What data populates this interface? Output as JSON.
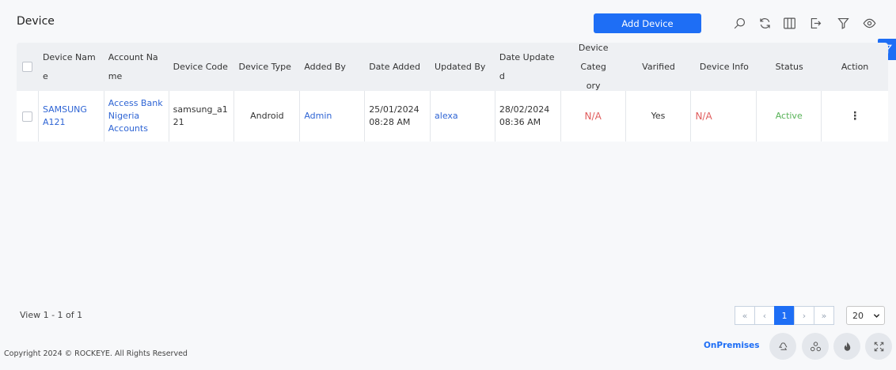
{
  "page": {
    "title": "Device"
  },
  "toolbar": {
    "add_label": "Add Device",
    "icons": [
      "search-icon",
      "refresh-icon",
      "columns-icon",
      "export-icon",
      "filter-icon",
      "view-icon"
    ]
  },
  "table": {
    "headers": [
      "Device Name",
      "Account Name",
      "Device Code",
      "Device Type",
      "Added By",
      "Date Added",
      "Updated By",
      "Date Updated",
      "Device Category",
      "Varified",
      "Device Info",
      "Status",
      "Action"
    ],
    "header_lines": {
      "device_name": [
        "Device Nam",
        "e"
      ],
      "account_name": [
        "Account Na",
        "me"
      ],
      "date_updated": [
        "Date Update",
        "d"
      ],
      "device_category": [
        "Device Categ",
        "ory"
      ]
    },
    "rows": [
      {
        "device_name_lines": [
          "SAMSUNG",
          "A121"
        ],
        "account_name_lines": [
          "Access Bank",
          "Nigeria",
          "Accounts"
        ],
        "device_code_lines": [
          "samsung_a1",
          "21"
        ],
        "device_type": "Android",
        "added_by": "Admin",
        "date_added_lines": [
          "25/01/2024",
          "08:28 AM"
        ],
        "updated_by": "alexa",
        "date_updated_lines": [
          "28/02/2024",
          "08:36 AM"
        ],
        "device_category": "N/A",
        "varified": "Yes",
        "device_info": "N/A",
        "status": "Active",
        "action": "⋮"
      }
    ]
  },
  "footer": {
    "view_count": "View 1 - 1 of 1",
    "pager": {
      "first": "«",
      "prev": "‹",
      "current": "1",
      "next": "›",
      "last": "»"
    },
    "page_size": "20",
    "copyright": "Copyright 2024 © ROCKEYE. All Rights Reserved",
    "mode": "OnPremises"
  },
  "colors": {
    "accent": "#1e6ef5",
    "link": "#2e64d4",
    "na": "#e05c5c",
    "active": "#57b257"
  }
}
